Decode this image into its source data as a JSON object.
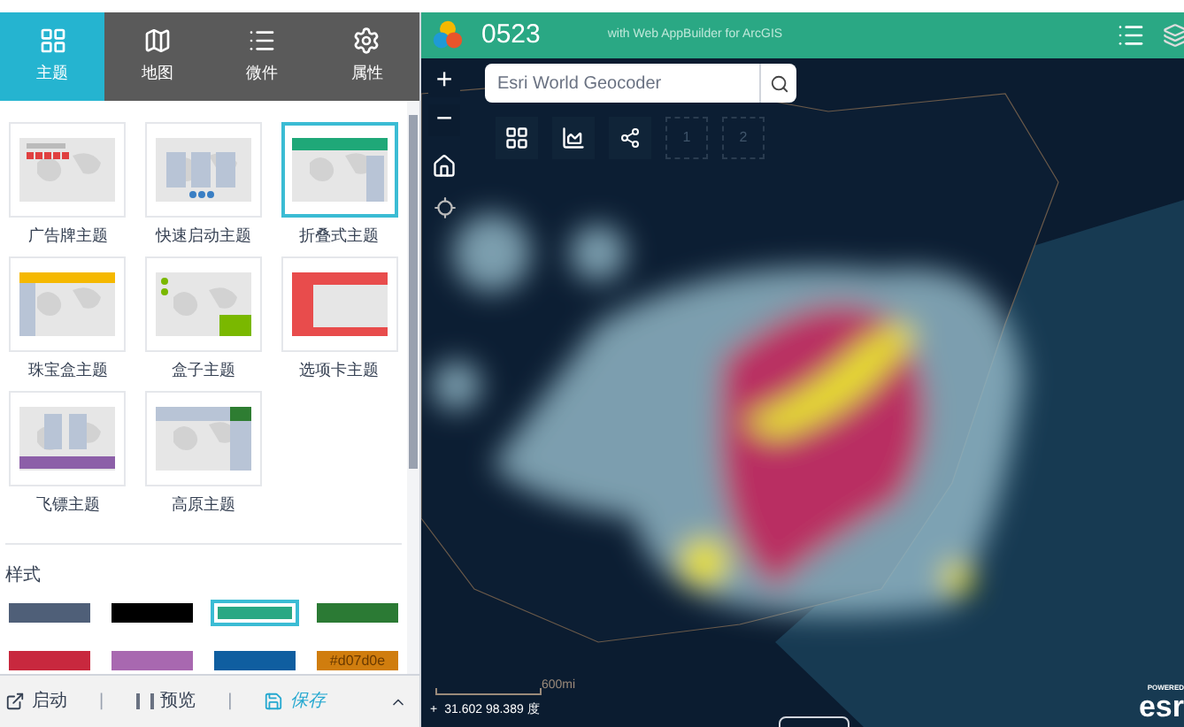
{
  "tabs": [
    {
      "label": "主题",
      "selected": true
    },
    {
      "label": "地图",
      "selected": false
    },
    {
      "label": "微件",
      "selected": false
    },
    {
      "label": "属性",
      "selected": false
    }
  ],
  "themes": [
    {
      "label": "广告牌主题",
      "selected": false
    },
    {
      "label": "快速启动主题",
      "selected": false
    },
    {
      "label": "折叠式主题",
      "selected": true
    },
    {
      "label": "珠宝盒主题",
      "selected": false
    },
    {
      "label": "盒子主题",
      "selected": false
    },
    {
      "label": "选项卡主题",
      "selected": false
    },
    {
      "label": "飞镖主题",
      "selected": false
    },
    {
      "label": "高原主题",
      "selected": false
    }
  ],
  "style_heading": "样式",
  "swatches": [
    {
      "color": "#4f5f78",
      "selected": false
    },
    {
      "color": "#000000",
      "selected": false
    },
    {
      "color": "#2aa884",
      "selected": true
    },
    {
      "color": "#2b7a34",
      "selected": false
    },
    {
      "color": "#c8283e",
      "selected": false
    },
    {
      "color": "#a868b0",
      "selected": false
    },
    {
      "color": "#0f5ea0",
      "selected": false
    },
    {
      "color": "#d07d0e",
      "selected": false,
      "label": "#d07d0e"
    }
  ],
  "footer": {
    "launch": "启动",
    "separator_1": "|",
    "preview": "预览",
    "separator_2": "|",
    "save": "保存"
  },
  "app": {
    "title": "0523",
    "subtitle": "with Web AppBuilder for ArcGIS"
  },
  "search": {
    "placeholder": "Esri World Geocoder"
  },
  "zoom": {
    "in": "+",
    "out": "−"
  },
  "toolbar_slots": [
    "1",
    "2"
  ],
  "scale": "600mi",
  "coordinates": {
    "toggle": "+",
    "value": "31.602 98.389 度"
  },
  "logo": {
    "powered": "POWERED",
    "name": "esr"
  }
}
